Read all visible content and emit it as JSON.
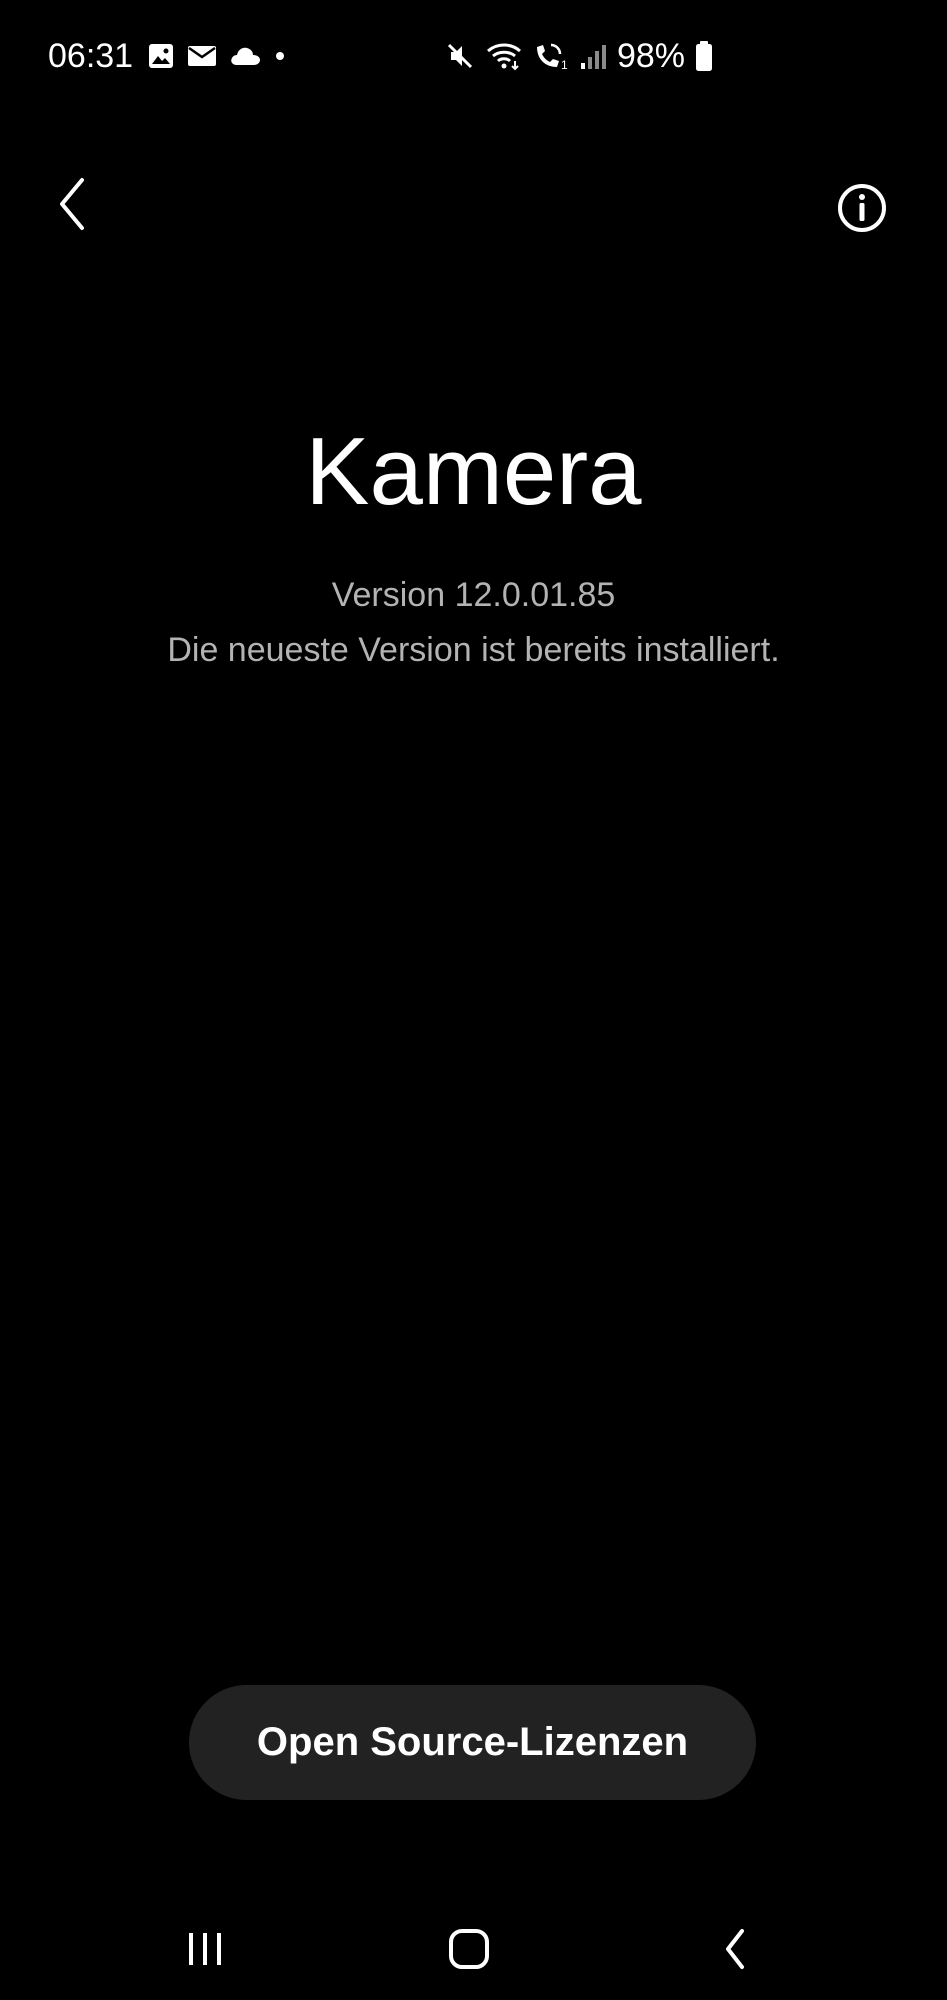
{
  "status_bar": {
    "time": "06:31",
    "battery": "98%",
    "left_icons": [
      "gallery-icon",
      "mail-icon",
      "cloud-icon",
      "dot-icon"
    ],
    "right_icons": [
      "mute-icon",
      "wifi-icon",
      "wifi-calling-icon",
      "signal-icon",
      "battery-icon"
    ]
  },
  "app_bar": {
    "back_icon": "chevron-left-icon",
    "info_icon": "info-icon"
  },
  "app": {
    "title": "Kamera",
    "version": "Version 12.0.01.85",
    "status": "Die neueste Version ist bereits installiert."
  },
  "actions": {
    "oss_label": "Open Source-Lizenzen"
  },
  "nav_bar": {
    "icons": [
      "recents-icon",
      "home-icon",
      "back-icon"
    ]
  },
  "colors": {
    "background": "#000000",
    "text_primary": "#ffffff",
    "text_secondary": "#b3b3b3",
    "button_bg": "#222222"
  }
}
